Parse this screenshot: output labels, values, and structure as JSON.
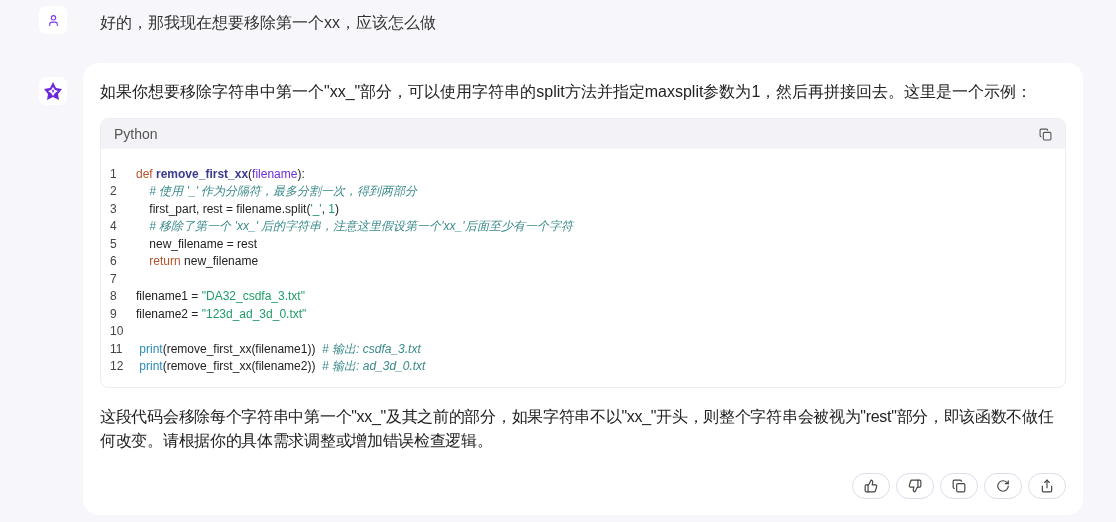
{
  "messages": [
    {
      "kind": "user",
      "text": "好的，那我现在想要移除第一个xx，应该怎么做"
    },
    {
      "kind": "assistant",
      "intro": "如果你想要移除字符串中第一个\"xx_\"部分，可以使用字符串的split方法并指定maxsplit参数为1，然后再拼接回去。这里是一个示例：",
      "code": {
        "language": "Python",
        "lines": [
          {
            "number": "1",
            "tokens": [
              {
                "kind": "keyword",
                "text": "def "
              },
              {
                "kind": "function",
                "text": "remove_first_xx"
              },
              {
                "kind": "plain",
                "text": "("
              },
              {
                "kind": "param",
                "text": "filename"
              },
              {
                "kind": "plain",
                "text": "):"
              }
            ]
          },
          {
            "number": "2",
            "tokens": [
              {
                "kind": "comment",
                "text": "    # 使用 '_' 作为分隔符，最多分割一次，得到两部分"
              }
            ]
          },
          {
            "number": "3",
            "tokens": [
              {
                "kind": "plain",
                "text": "    first_part, rest = filename.split("
              },
              {
                "kind": "string",
                "text": "'_'"
              },
              {
                "kind": "plain",
                "text": ", "
              },
              {
                "kind": "number",
                "text": "1"
              },
              {
                "kind": "plain",
                "text": ")"
              }
            ]
          },
          {
            "number": "4",
            "tokens": [
              {
                "kind": "comment",
                "text": "    # 移除了第一个 'xx_' 后的字符串，注意这里假设第一个'xx_'后面至少有一个字符"
              }
            ]
          },
          {
            "number": "5",
            "tokens": [
              {
                "kind": "plain",
                "text": "    new_filename = rest"
              }
            ]
          },
          {
            "number": "6",
            "tokens": [
              {
                "kind": "keyword",
                "text": "    return "
              },
              {
                "kind": "plain",
                "text": "new_filename"
              }
            ]
          },
          {
            "number": "7"
          },
          {
            "number": "8",
            "tokens": [
              {
                "kind": "plain",
                "text": "filename1 = "
              },
              {
                "kind": "string",
                "text": "\"DA32_csdfa_3.txt\""
              }
            ]
          },
          {
            "number": "9",
            "tokens": [
              {
                "kind": "plain",
                "text": "filename2 = "
              },
              {
                "kind": "string",
                "text": "\"123d_ad_3d_0.txt\""
              }
            ]
          },
          {
            "number": "10"
          },
          {
            "number": "11",
            "tokens": [
              {
                "kind": "builtin",
                "text": " print"
              },
              {
                "kind": "plain",
                "text": "(remove_first_xx(filename1))  "
              },
              {
                "kind": "comment",
                "text": "# 输出: csdfa_3.txt"
              }
            ]
          },
          {
            "number": "12",
            "tokens": [
              {
                "kind": "builtin",
                "text": " print"
              },
              {
                "kind": "plain",
                "text": "(remove_first_xx(filename2))  "
              },
              {
                "kind": "comment",
                "text": "# 输出: ad_3d_0.txt"
              }
            ]
          }
        ]
      },
      "outro": "这段代码会移除每个字符串中第一个\"xx_\"及其之前的部分，如果字符串不以\"xx_\"开头，则整个字符串会被视为\"rest\"部分，即该函数不做任何改变。请根据你的具体需求调整或增加错误检查逻辑。",
      "actions": [
        {
          "kind": "like"
        },
        {
          "kind": "dislike"
        },
        {
          "kind": "copy"
        },
        {
          "kind": "regenerate"
        },
        {
          "kind": "share"
        }
      ]
    }
  ]
}
